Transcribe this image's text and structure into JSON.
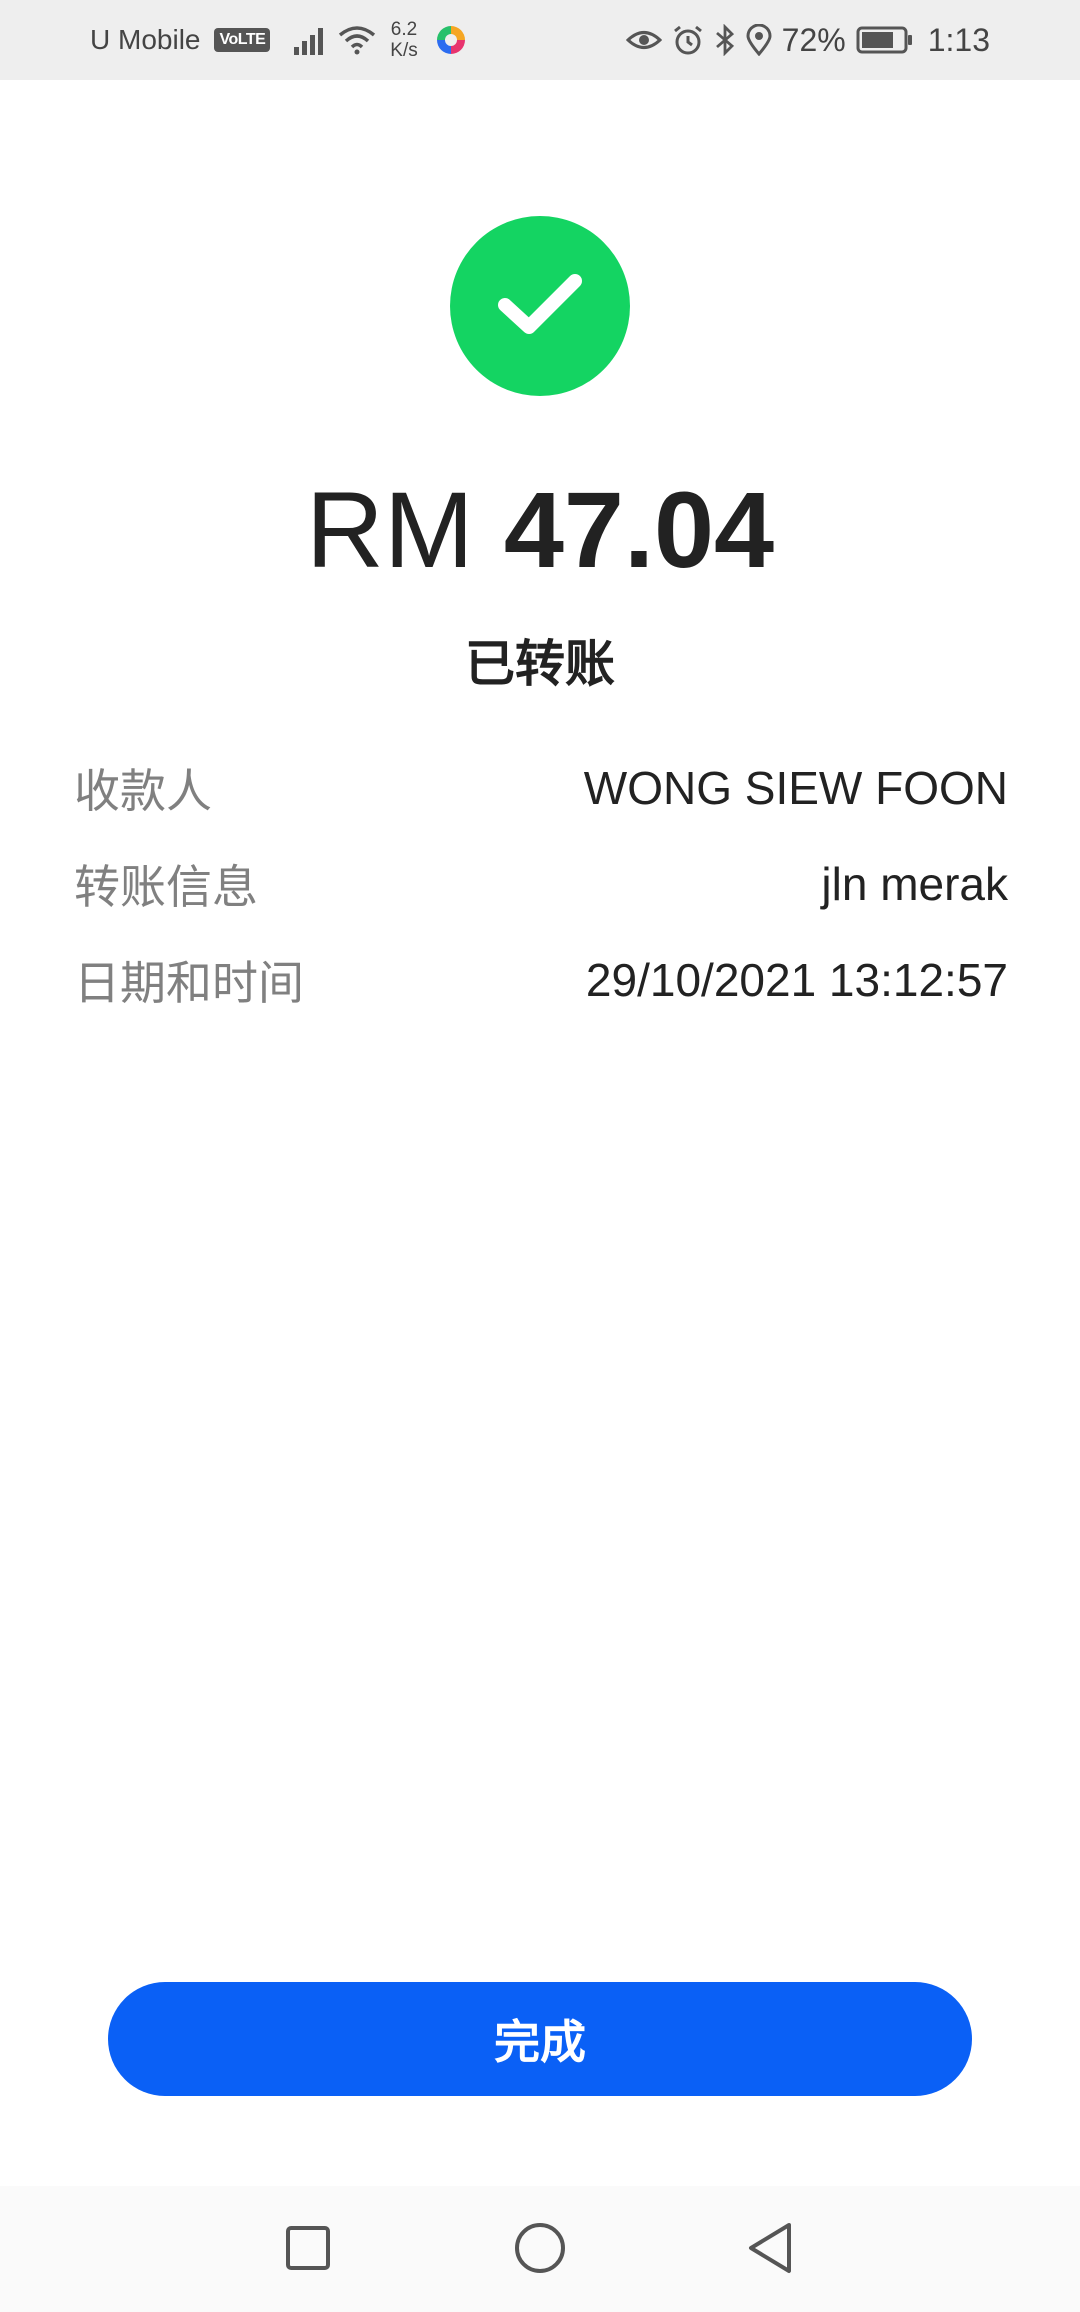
{
  "status_bar": {
    "carrier": "U Mobile",
    "volte": "VoLTE",
    "net_speed_value": "6.2",
    "net_speed_unit": "K/s",
    "battery_percent": "72%",
    "time": "1:13",
    "icons": [
      "signal-icon",
      "wifi-icon",
      "app-logo-icon",
      "eye-icon",
      "alarm-icon",
      "bluetooth-icon",
      "location-icon",
      "battery-icon"
    ]
  },
  "result": {
    "icon": "checkmark-icon",
    "currency": "RM",
    "amount": "47.04",
    "status": "已转账"
  },
  "details": [
    {
      "label": "收款人",
      "value": "WONG SIEW FOON"
    },
    {
      "label": "转账信息",
      "value": "jln merak"
    },
    {
      "label": "日期和时间",
      "value": "29/10/2021 13:12:57"
    }
  ],
  "actions": {
    "done_label": "完成"
  },
  "nav": {
    "icons": [
      "recent-apps-icon",
      "home-icon",
      "back-icon"
    ]
  },
  "colors": {
    "success": "#14d462",
    "primary": "#0a60f6",
    "text": "#222222",
    "label": "#808080"
  }
}
